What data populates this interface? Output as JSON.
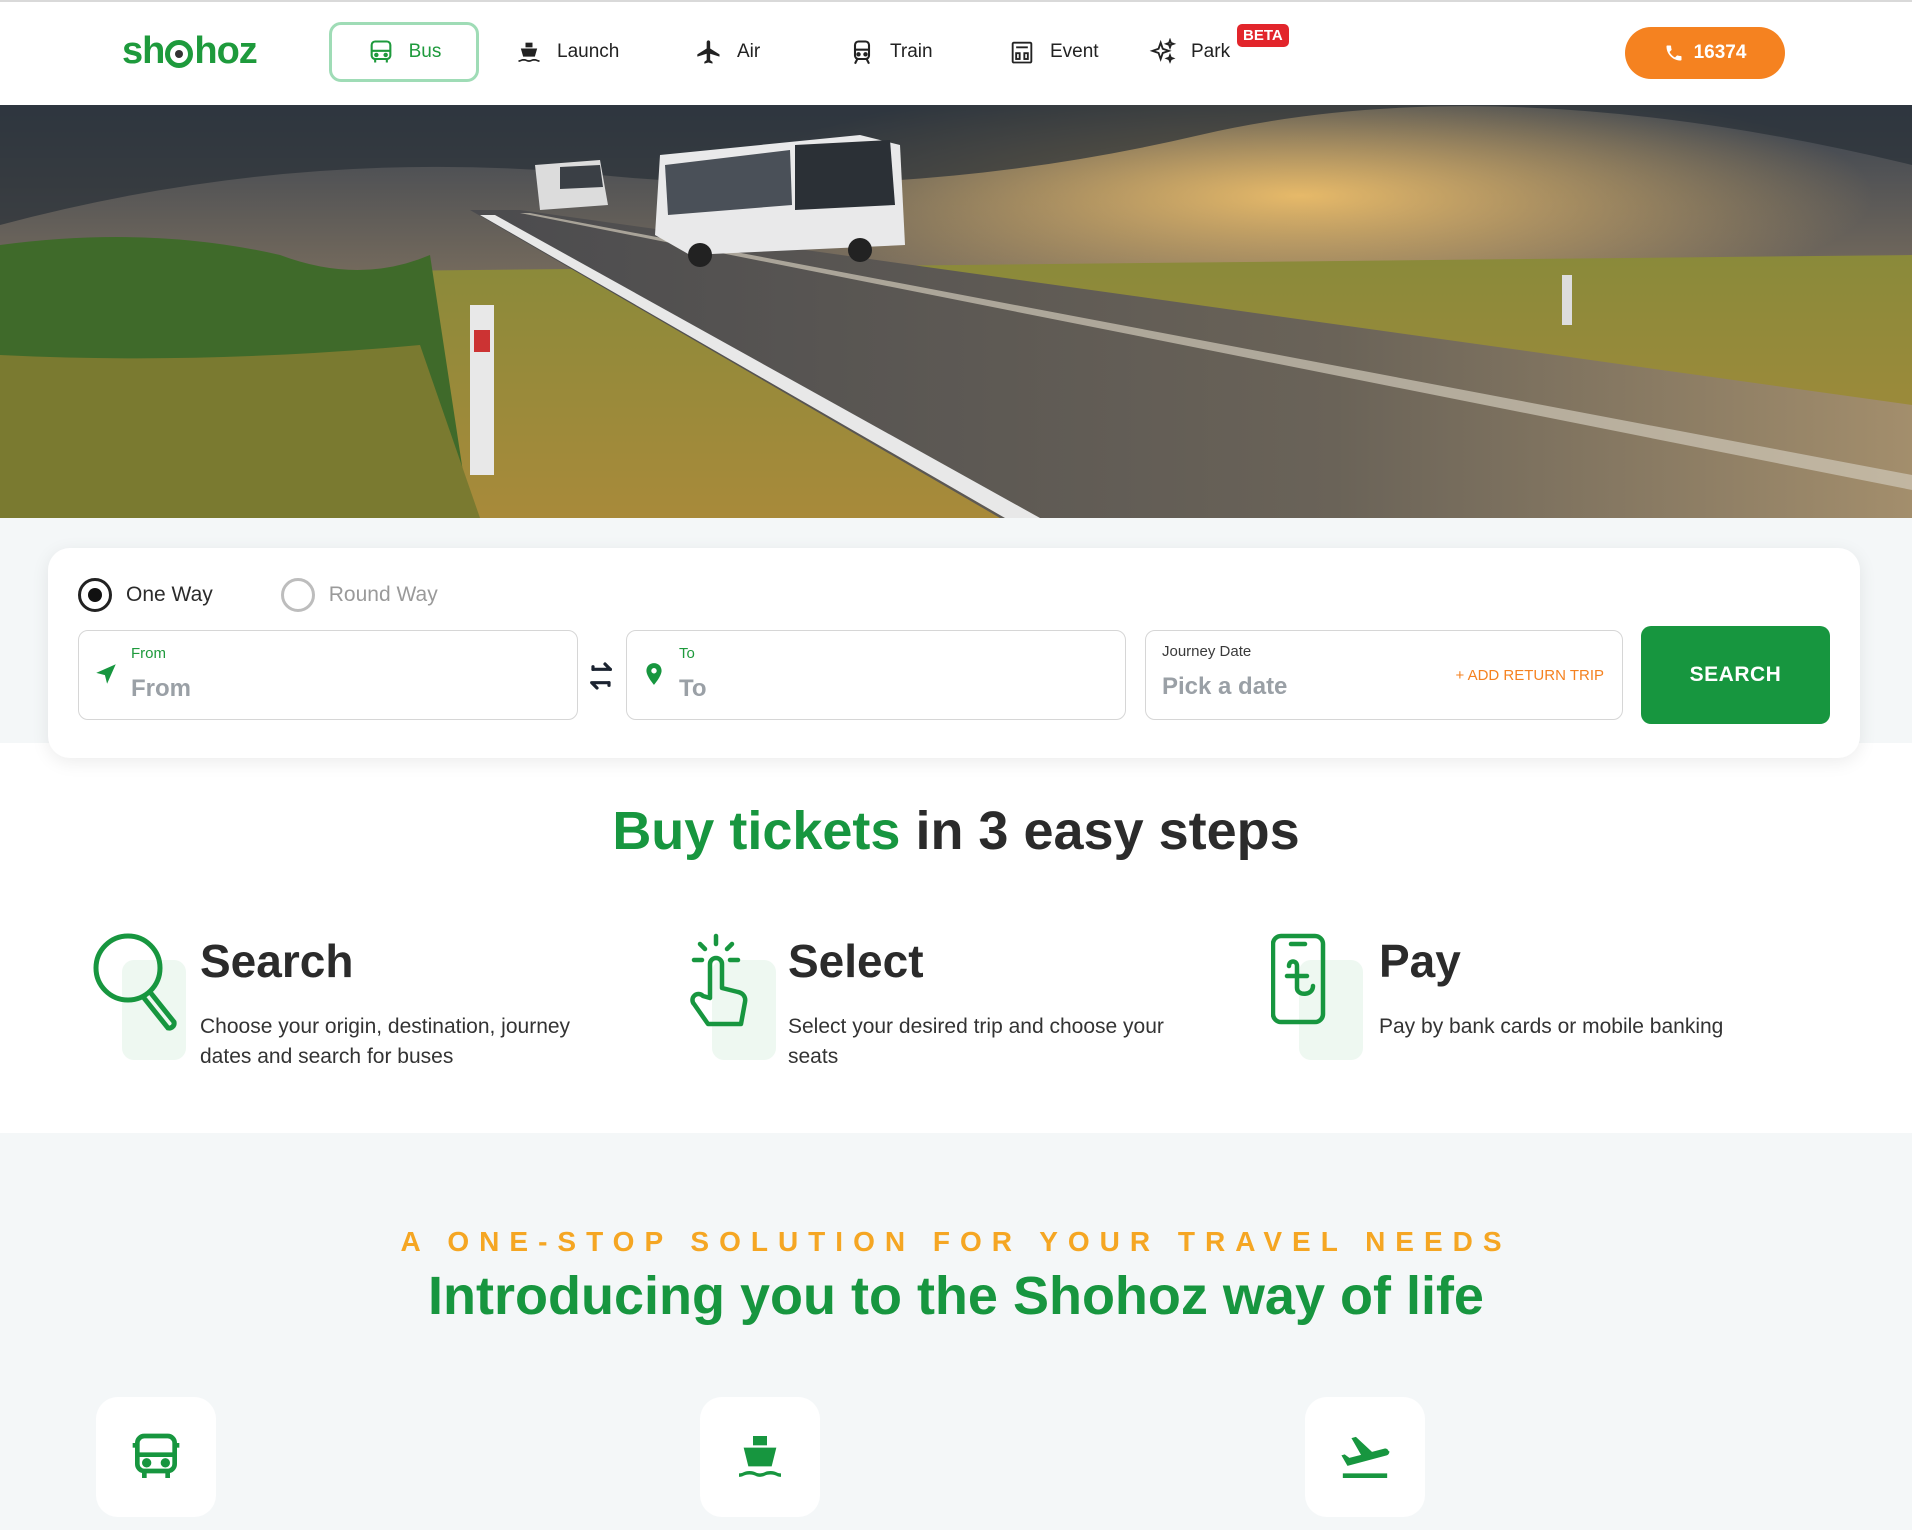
{
  "brand": {
    "logo_text_left": "sh",
    "logo_text_right": "hoz",
    "primary_color": "#17963f",
    "accent_color": "#f58220"
  },
  "nav": {
    "items": [
      {
        "label": "Bus",
        "icon": "bus-icon",
        "active": true
      },
      {
        "label": "Launch",
        "icon": "ship-icon"
      },
      {
        "label": "Air",
        "icon": "plane-icon"
      },
      {
        "label": "Train",
        "icon": "train-icon"
      },
      {
        "label": "Event",
        "icon": "event-icon"
      },
      {
        "label": "Park",
        "icon": "sparkle-icon",
        "badge": "BETA"
      }
    ],
    "phone_label": "16374"
  },
  "hero": {
    "image": "bus-on-highway-photo"
  },
  "search": {
    "trip_types": [
      {
        "label": "One Way",
        "selected": true
      },
      {
        "label": "Round Way",
        "selected": false
      }
    ],
    "from": {
      "label": "From",
      "placeholder": "From"
    },
    "to": {
      "label": "To",
      "placeholder": "To"
    },
    "date": {
      "label": "Journey Date",
      "placeholder": "Pick a date",
      "return_link": "+ ADD RETURN TRIP"
    },
    "button_label": "SEARCH"
  },
  "steps": {
    "title_highlight": "Buy tickets",
    "title_rest": " in 3 easy steps",
    "items": [
      {
        "title": "Search",
        "desc": "Choose your origin, destination, journey dates and search for buses",
        "icon": "magnifier-icon"
      },
      {
        "title": "Select",
        "desc": "Select your desired trip and choose your seats",
        "icon": "tap-hand-icon"
      },
      {
        "title": "Pay",
        "desc": "Pay by bank cards or mobile banking",
        "icon": "phone-taka-icon"
      }
    ]
  },
  "about": {
    "tagline": "A ONE-STOP SOLUTION FOR YOUR TRAVEL NEEDS",
    "title": "Introducing you to the Shohoz way of life",
    "tiles": [
      {
        "icon": "bus-icon"
      },
      {
        "icon": "ship-icon"
      },
      {
        "icon": "plane-icon"
      }
    ]
  }
}
